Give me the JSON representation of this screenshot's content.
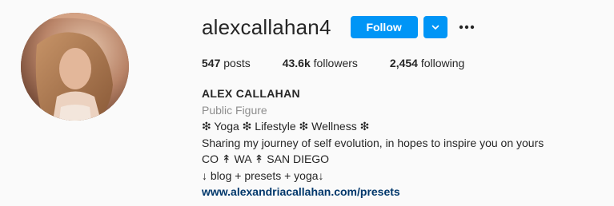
{
  "profile": {
    "username": "alexcallahan4",
    "follow_label": "Follow",
    "dropdown_icon": "chevron-down-icon",
    "more_icon": "more-options-icon",
    "stats": {
      "posts_count": "547",
      "posts_label": "posts",
      "followers_count": "43.6k",
      "followers_label": "followers",
      "following_count": "2,454",
      "following_label": "following"
    },
    "bio": {
      "full_name": "ALEX CALLAHAN",
      "category": "Public Figure",
      "lines": [
        "❇ Yoga ❇ Lifestyle ❇ Wellness ❇",
        "Sharing my journey of self evolution, in hopes to inspire you on yours",
        "CO ↟ WA ↟ SAN DIEGO",
        "↓ blog + presets + yoga↓"
      ],
      "website": "www.alexandriacallahan.com/presets"
    }
  },
  "colors": {
    "background": "#fafafa",
    "accent_blue": "#0095f6",
    "link_blue": "#00376b",
    "secondary_text": "#8e8e8e",
    "primary_text": "#262626"
  }
}
